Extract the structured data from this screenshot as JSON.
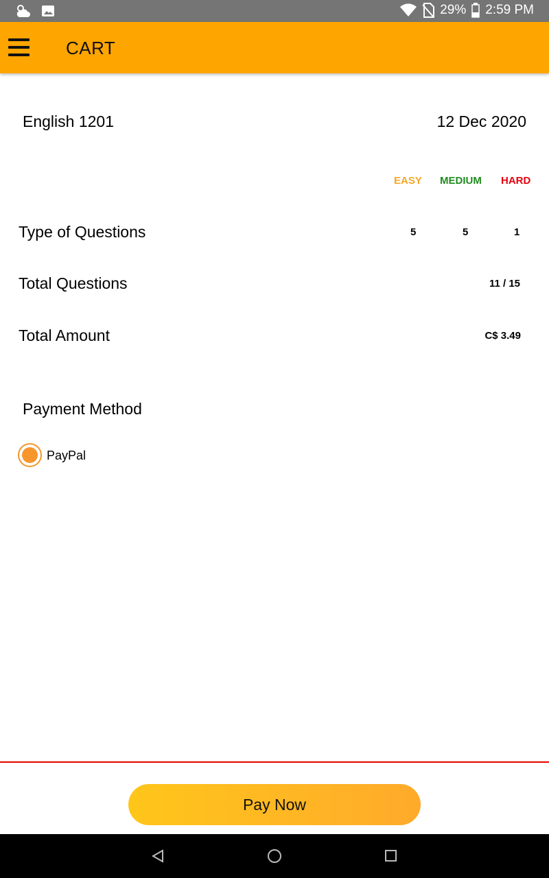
{
  "status_bar": {
    "battery": "29%",
    "time": "2:59 PM",
    "icons": [
      "weather-icon",
      "image-icon",
      "wifi-icon",
      "no-sim-icon",
      "battery-icon"
    ]
  },
  "app_bar": {
    "title": "CART",
    "menu_icon": "hamburger-menu-icon",
    "color": "#FFA500"
  },
  "cart": {
    "course": "English 1201",
    "date": "12 Dec 2020",
    "levels": {
      "easy": {
        "label": "EASY",
        "color": "#F5A623"
      },
      "medium": {
        "label": "MEDIUM",
        "color": "#1E8B1E"
      },
      "hard": {
        "label": "HARD",
        "color": "#E3000F"
      }
    },
    "type_of_questions": {
      "label": "Type of Questions",
      "easy": "5",
      "medium": "5",
      "hard": "1"
    },
    "total_questions": {
      "label": "Total Questions",
      "value": "11 / 15"
    },
    "total_amount": {
      "label": "Total Amount",
      "value": "C$ 3.49"
    }
  },
  "payment": {
    "title": "Payment Method",
    "options": [
      {
        "label": "PayPal",
        "selected": true
      }
    ]
  },
  "footer": {
    "pay_button": "Pay Now",
    "divider_color": "#E60000"
  },
  "nav_bar": {
    "icons": [
      "back-icon",
      "home-icon",
      "recents-icon"
    ]
  }
}
